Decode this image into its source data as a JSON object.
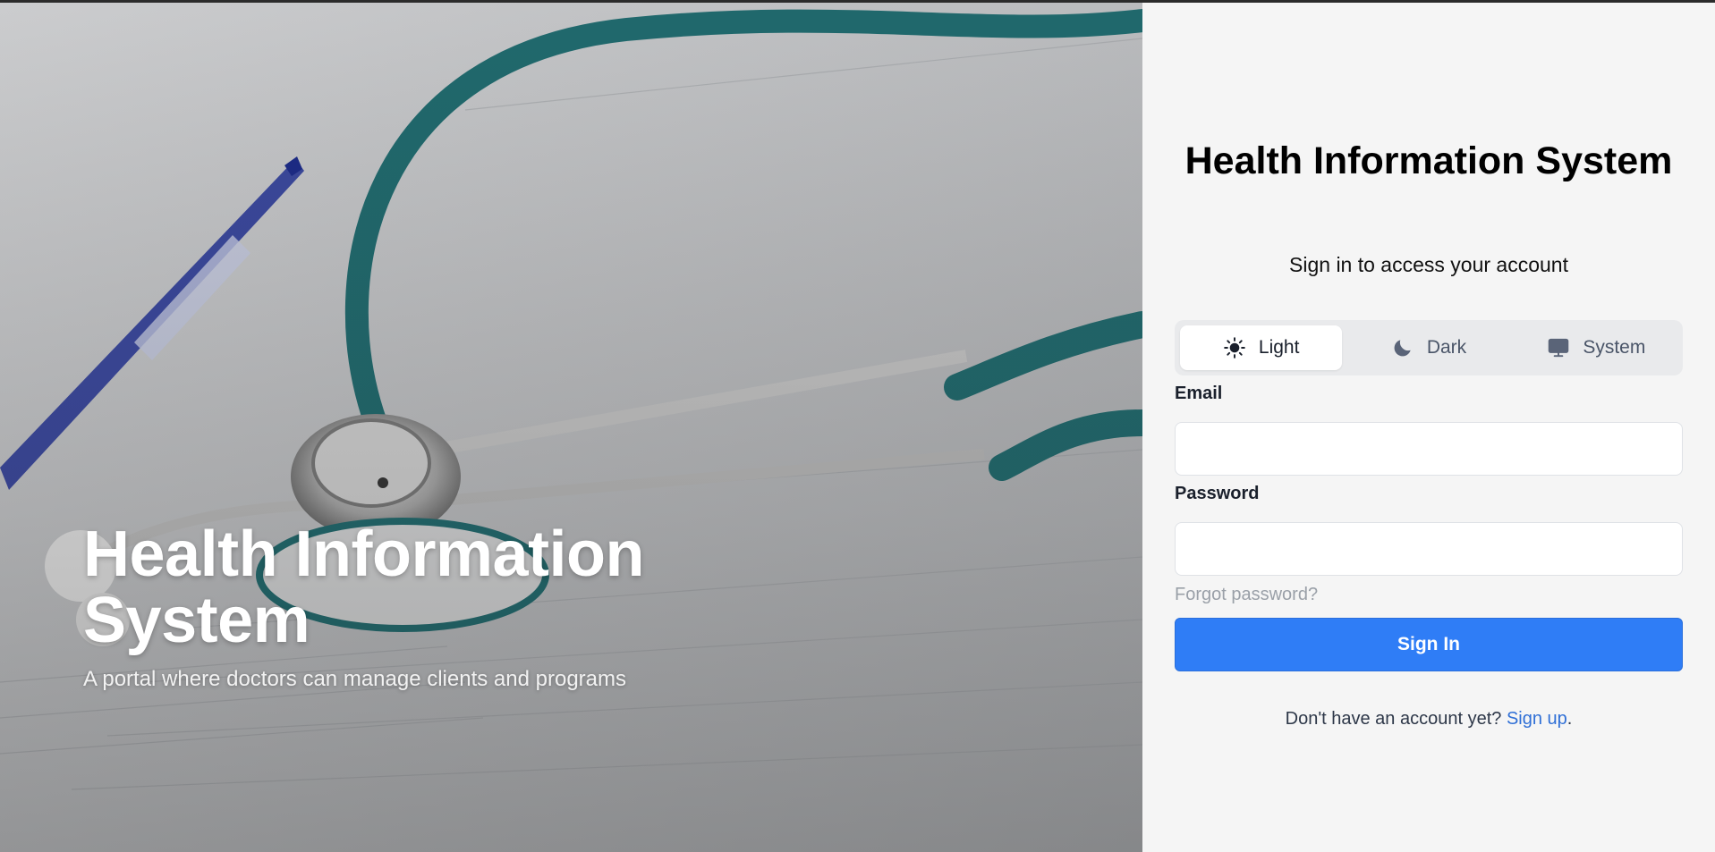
{
  "hero": {
    "title": "Health Information System",
    "subtitle": "A portal where doctors can manage clients and programs"
  },
  "panel": {
    "title": "Health Information System",
    "subtitle": "Sign in to access your account"
  },
  "theme_switch": {
    "options": [
      {
        "label": "Light",
        "icon": "sun-icon",
        "active": true
      },
      {
        "label": "Dark",
        "icon": "moon-icon",
        "active": false
      },
      {
        "label": "System",
        "icon": "monitor-icon",
        "active": false
      }
    ]
  },
  "form": {
    "email_label": "Email",
    "email_value": "",
    "password_label": "Password",
    "password_value": "",
    "forgot_link": "Forgot password?",
    "submit_label": "Sign In",
    "signup_prompt": "Don't have an account yet?",
    "signup_link": "Sign up",
    "signup_suffix": "."
  },
  "colors": {
    "primary": "#2f7df6",
    "link": "#2f6fd6",
    "muted_link": "#9aa0a8",
    "panel_bg": "#f5f5f5"
  }
}
